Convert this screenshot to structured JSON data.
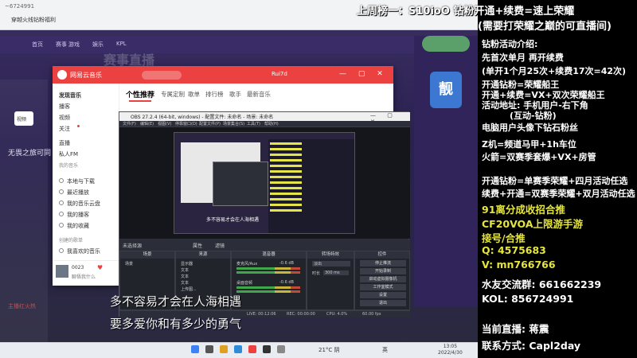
{
  "browser": {
    "address_text": "~6724991",
    "tab_title": "穿越火线钻粉福利",
    "nav_items": [
      "首页",
      "赛事",
      "游戏",
      "娱乐",
      "KPL"
    ],
    "banner_text": "赛事直播",
    "side_label": "视频",
    "side_heading": "无畏之旅可同",
    "side_footer": "主播红火热",
    "badge_text": "靓"
  },
  "netease": {
    "app_name": "网易云音乐",
    "user_name": "Rui7d",
    "sidebar_items": [
      {
        "label": "发现音乐",
        "section": false
      },
      {
        "label": "播客",
        "section": false
      },
      {
        "label": "视频",
        "section": false
      },
      {
        "label": "关注",
        "section": false,
        "dot": true
      },
      {
        "label": "直播",
        "section": false
      },
      {
        "label": "私人FM",
        "section": false
      },
      {
        "label": "我的音乐",
        "section": true
      },
      {
        "label": "本地与下载",
        "section": false
      },
      {
        "label": "最近播放",
        "section": false
      },
      {
        "label": "我的音乐云盘",
        "section": false
      },
      {
        "label": "我的播客",
        "section": false
      },
      {
        "label": "我的收藏",
        "section": false
      },
      {
        "label": "创建的歌单",
        "section": true
      },
      {
        "label": "我喜欢的音乐",
        "section": false
      }
    ],
    "tabs": [
      "个性推荐",
      "专属定制",
      "歌单",
      "排行榜",
      "歌手",
      "最新音乐"
    ],
    "player_song": "0023",
    "player_artist": "聊悟我什么"
  },
  "obs": {
    "title": "OBS 27.2.4 (64-bit, windows) - 配置文件: 未命名 - 场景: 未命名",
    "menu": [
      "文件(F)",
      "编辑(E)",
      "视图(V)",
      "停靠窗口(D)",
      "配置文件(P)",
      "场景集合(S)",
      "工具(T)",
      "帮助(H)"
    ],
    "scene_bar_label": "未选择源",
    "scene_bar_props": "属性",
    "scene_bar_filters": "滤镜",
    "docks": {
      "scenes": "场景",
      "sources": "来源",
      "mixer": "混音器",
      "transitions": "转场特效",
      "controls": "控件"
    },
    "scene_name": "场景",
    "sources": [
      "显示器",
      "文本",
      "文本",
      "文本",
      "上传图..."
    ],
    "mixer_tracks": [
      "麦克风/Aux",
      "桌面音频"
    ],
    "mixer_db": [
      "-0.6 dB",
      "-0.6 dB"
    ],
    "transition_name": "淡出",
    "transition_duration_label": "时长",
    "transition_duration": "300 ms",
    "controls": [
      "停止推流",
      "开始录制",
      "启动虚拟摄像机",
      "工作室模式",
      "设置",
      "退出"
    ],
    "status": {
      "live": "LIVE: 00:12:06",
      "rec": "REC: 00:00:00",
      "cpu": "CPU: 4.0%",
      "fps": "60.00 fps"
    },
    "preview_lyric": "多不容易才会在人海相遇"
  },
  "lyrics": {
    "line1": "多不容易才会在人海相遇",
    "line2": "要多爱你和有多少的勇气"
  },
  "taskbar": {
    "weather": "21°C 阴",
    "lang": "英",
    "time": "13:05",
    "date": "2022/4/30"
  },
  "overlay": {
    "top_banner": "上周榜一：S10ioO 钻粉开通+续费=速上荣耀",
    "top_banner2": "(需要打荣耀之巅的可直播间)",
    "lines": [
      "钻粉活动介绍:",
      "先首次单月 再开续费",
      "(单开1个月25次+续费17次=42次)",
      "开通钻粉=荣耀船王",
      "开通+续费=VX+双次荣耀船王",
      "活动地址: 手机用户-右下角",
      "(互动-钻粉)",
      "电脑用户头像下钻石粉丝",
      "Z机=频道马甲+1h车位",
      "火箭=双赛季套爆+VX+房管",
      "开通钻粉=单赛季荣耀+四月活动任选",
      "续费+开通=双赛季荣耀+双月活动任选",
      "91离分成收招合推",
      "CF20VOA上限游手游",
      "接号/合推",
      "Q: 4575683",
      "V: mn766766",
      "水友交流群: 661662239",
      "KOL: 856724991",
      "当前直播: 蒋震",
      "联系方式: Capl2day"
    ]
  },
  "colors": {
    "netease_red": "#ec4141",
    "overlay_yellow": "#e5e53c",
    "overlay_bg": "#000000"
  }
}
